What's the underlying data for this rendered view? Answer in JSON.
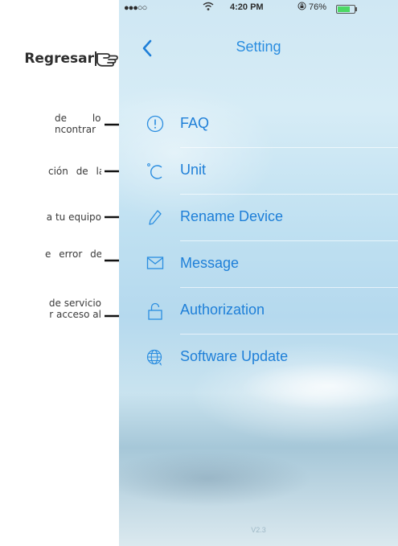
{
  "annotations": {
    "back_label": "Regresar",
    "faq_text_line1": "de los",
    "faq_text_line2": "ncontrar",
    "unit_text": "ción de la",
    "rename_text": "a tu equipo",
    "message_text": "e error del",
    "auth_text_line1": "de servicio",
    "auth_text_line2": "r acceso al"
  },
  "statusbar": {
    "signal": "●●●○○",
    "wifi_icon": "wifi-icon",
    "time": "4:20 PM",
    "lock_icon": "rotation-lock-icon",
    "battery_percent": "76%",
    "battery_level": 0.76
  },
  "navbar": {
    "back_icon": "chevron-left-icon",
    "title": "Setting"
  },
  "menu": [
    {
      "label": "FAQ",
      "icon": "info-circle-icon",
      "glyph": "ⓘ"
    },
    {
      "label": "Unit",
      "icon": "degree-celsius-icon",
      "glyph": "°C"
    },
    {
      "label": "Rename Device",
      "icon": "pencil-icon",
      "glyph": "✎"
    },
    {
      "label": "Message",
      "icon": "mail-icon",
      "glyph": "✉"
    },
    {
      "label": "Authorization",
      "icon": "unlock-icon",
      "glyph": "🔓"
    },
    {
      "label": "Software Update",
      "icon": "globe-update-icon",
      "glyph": "⊕"
    }
  ],
  "version": "V2.3",
  "colors": {
    "accent": "#2a8de0",
    "annotation_text": "#3a3a3a"
  }
}
